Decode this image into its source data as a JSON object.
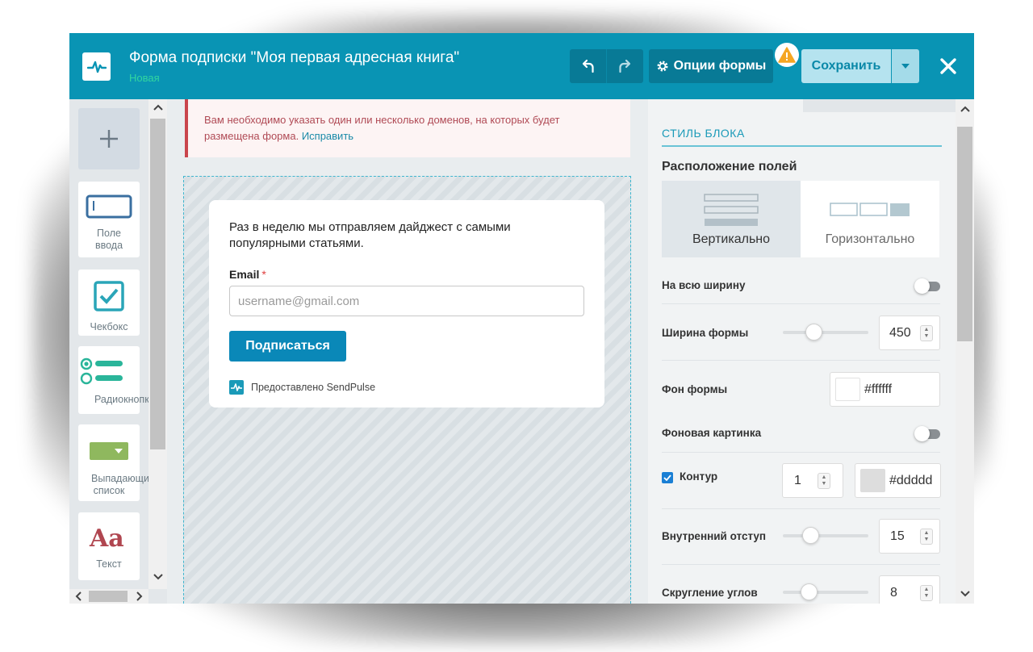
{
  "header": {
    "title": "Форма подписки \"Моя первая адресная книга\"",
    "status": "Новая",
    "options_label": "Опции формы",
    "save_label": "Сохранить"
  },
  "palette": {
    "items": [
      {
        "label_line1": "Поле",
        "label_line2": "ввода"
      },
      {
        "label_line1": "Чекбокс",
        "label_line2": ""
      },
      {
        "label_line1": "Радиокнопки",
        "label_line2": ""
      },
      {
        "label_line1": "Выпадающий",
        "label_line2": "список"
      },
      {
        "label_line1": "Текст",
        "label_line2": ""
      }
    ]
  },
  "alert": {
    "text": "Вам необходимо указать один или несколько доменов, на которых будет размещена форма.",
    "link": "Исправить"
  },
  "form": {
    "description": "Раз в неделю мы отправляем дайджест с самыми популярными статьями.",
    "email_label": "Email",
    "required_mark": "*",
    "email_placeholder": "username@gmail.com",
    "submit_label": "Подписаться",
    "powered_by": "Предоставлено SendPulse"
  },
  "panel": {
    "section_title": "СТИЛЬ БЛОКА",
    "layout_label": "Расположение полей",
    "layout_options": [
      "Вертикально",
      "Горизонтально"
    ],
    "layout_selected": "Вертикально",
    "full_width_label": "На всю ширину",
    "full_width_on": false,
    "form_width_label": "Ширина формы",
    "form_width_value": "450",
    "form_bg_label": "Фон формы",
    "form_bg_value": "#ffffff",
    "bg_image_label": "Фоновая картинка",
    "bg_image_on": false,
    "border_label": "Контур",
    "border_checked": true,
    "border_width_value": "1",
    "border_color_value": "#ddddd",
    "padding_label": "Внутренний отступ",
    "padding_value": "15",
    "radius_label": "Скругление углов",
    "radius_value": "8"
  },
  "colors": {
    "header_bg": "#0994b4",
    "accent": "#0a88b8",
    "status_green": "#32d6a0",
    "alert_red": "#c9454c",
    "warning": "#f5a623"
  }
}
